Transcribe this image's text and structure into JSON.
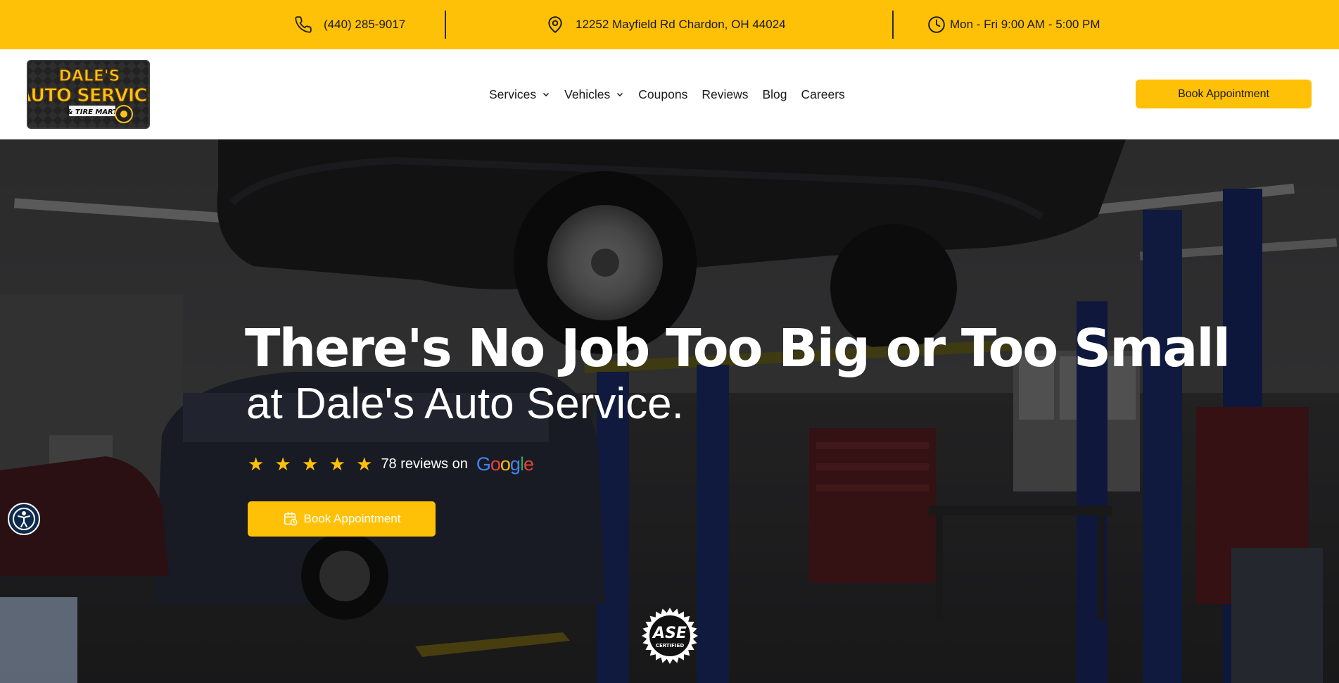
{
  "topbar": {
    "phone": "(440) 285-9017",
    "address": "12252 Mayfield Rd Chardon, OH 44024",
    "hours": "Mon - Fri 9:00 AM - 5:00 PM",
    "icons": [
      "phone-icon",
      "map-pin-icon",
      "clock-icon"
    ],
    "background": "#FFC107"
  },
  "header": {
    "logo": {
      "line1": "DALE'S",
      "line2": "AUTO SERVICE",
      "line3": "& TIRE MART"
    },
    "nav": [
      {
        "label": "Services",
        "dropdown": true
      },
      {
        "label": "Vehicles",
        "dropdown": true
      },
      {
        "label": "Coupons",
        "dropdown": false
      },
      {
        "label": "Reviews",
        "dropdown": false
      },
      {
        "label": "Blog",
        "dropdown": false
      },
      {
        "label": "Careers",
        "dropdown": false
      }
    ],
    "cta_label": "Book Appointment"
  },
  "hero": {
    "title": "There's No Job Too Big or Too Small",
    "subtitle": "at Dale's Auto Service.",
    "stars": "★ ★ ★ ★ ★",
    "rating_value": 5,
    "reviews_text": "78 reviews on",
    "google_letters": [
      "G",
      "o",
      "o",
      "g",
      "l",
      "e"
    ],
    "google_colors": [
      "#4285F4",
      "#EA4335",
      "#FBBC05",
      "#4285F4",
      "#34A853",
      "#EA4335"
    ],
    "cta_label": "Book Appointment",
    "badge": {
      "line1": "ASE",
      "line2": "CERTIFIED"
    }
  },
  "colors": {
    "accent": "#FFC107",
    "text_dark": "#1a1a1a",
    "accessibility_bg": "#0c2a4d"
  }
}
